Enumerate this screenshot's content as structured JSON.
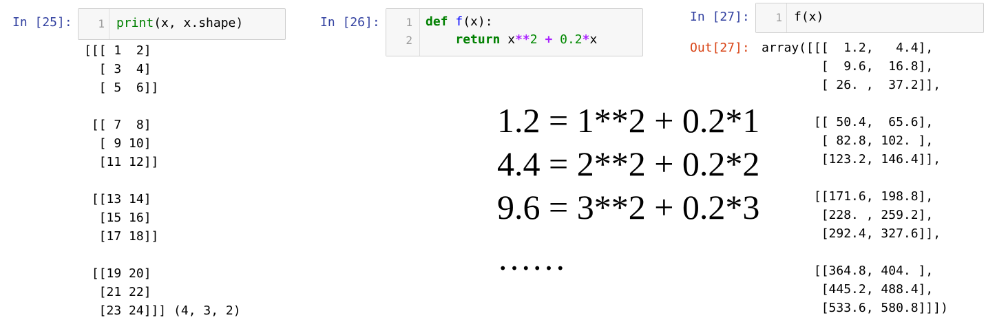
{
  "cell25": {
    "prompt": "In [25]:",
    "line_number": "1",
    "code": {
      "fn": "print",
      "rest": "(x, x.shape)"
    },
    "output": "[[[ 1  2]\n  [ 3  4]\n  [ 5  6]]\n\n [[ 7  8]\n  [ 9 10]\n  [11 12]]\n\n [[13 14]\n  [15 16]\n  [17 18]]\n\n [[19 20]\n  [21 22]\n  [23 24]]] (4, 3, 2)"
  },
  "cell26": {
    "prompt": "In [26]:",
    "line_numbers": [
      "1",
      "2"
    ],
    "line1": {
      "kw": "def",
      "fn": "f",
      "rest": "(x):"
    },
    "line2": {
      "indent": "    ",
      "kw": "return",
      "a": " x",
      "op1": "**",
      "b": "2 ",
      "op2": "+",
      "c": " 0.2",
      "op3": "*",
      "d": "x"
    }
  },
  "cell27": {
    "prompt": "In [27]:",
    "line_number": "1",
    "code": "f(x)",
    "out_prompt": "Out[27]:",
    "output": "array([[[  1.2,   4.4],\n        [  9.6,  16.8],\n        [ 26. ,  37.2]],\n\n       [[ 50.4,  65.6],\n        [ 82.8, 102. ],\n        [123.2, 146.4]],\n\n       [[171.6, 198.8],\n        [228. , 259.2],\n        [292.4, 327.6]],\n\n       [[364.8, 404. ],\n        [445.2, 488.4],\n        [533.6, 580.8]]])"
  },
  "annotation": {
    "lines": [
      "1.2 = 1**2 + 0.2*1",
      "4.4 = 2**2 + 0.2*2",
      "9.6 = 3**2 + 0.2*3",
      "……"
    ]
  }
}
